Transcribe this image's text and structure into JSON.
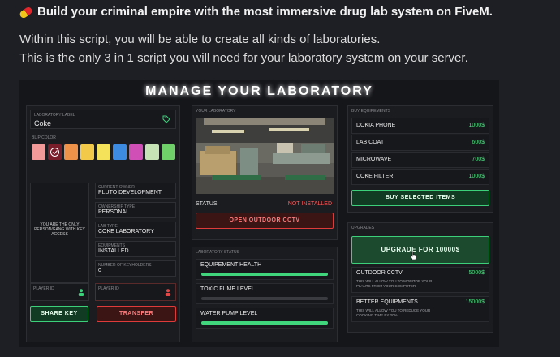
{
  "post": {
    "headline": "Build your criminal empire with the most immersive drug lab system on FiveM.",
    "line1": "Within this script, you will be able to create all kinds of laboratories.",
    "line2": "This is the only 3 in 1 script you will need for your laboratory system on your server."
  },
  "ui": {
    "title": "MANAGE YOUR LABORATORY",
    "lab_label_caption": "LABORATORY LABEL",
    "lab_label_value": "Coke",
    "blip_color_caption": "BLIP COLOR",
    "blip_colors": [
      "#f29a9a",
      "#7a1d2b",
      "#ee9149",
      "#f3c94a",
      "#f4e25a",
      "#3d8be0",
      "#d04fb6",
      "#c6e3b5",
      "#6fd06a"
    ],
    "key_access_text": "YOU ARE THE ONLY PERSON/GANG WITH KEY ACCESS",
    "owner_caption": "CURRENT OWNER",
    "owner_value": "PLUTO DEVELOPMENT",
    "ownership_caption": "OWNERSHIP TYPE",
    "ownership_value": "PERSONAL",
    "labtype_caption": "LAB TYPE",
    "labtype_value": "COKE LABORATORY",
    "equipments_caption": "EQUIPMENTS",
    "equipments_value": "INSTALLED",
    "keyholders_caption": "NUMBER OF KEYHOLDERS",
    "keyholders_value": "0",
    "player_id_caption": "PLAYER ID",
    "player_id_caption2": "PLAYER ID",
    "share_key": "SHARE KEY",
    "transfer": "TRANSFER",
    "your_lab_caption": "YOUR LABORATORY",
    "status_label": "STATUS",
    "status_value": "NOT INSTALLED",
    "cctv_button": "OPEN OUTDOOR CCTV",
    "lab_status_caption": "LABORATORY STATUS",
    "statuses": [
      {
        "name": "EQUIPEMENT HEALTH",
        "level": 1.0
      },
      {
        "name": "TOXIC FUME LEVEL",
        "level": 0.0
      },
      {
        "name": "WATER PUMP LEVEL",
        "level": 1.0
      }
    ],
    "buy_caption": "BUY EQUIPEMENTS",
    "equipment": [
      {
        "name": "DOKIA PHONE",
        "price": "1000$"
      },
      {
        "name": "LAB COAT",
        "price": "600$"
      },
      {
        "name": "MICROWAVE",
        "price": "700$"
      },
      {
        "name": "COKE FILTER",
        "price": "1000$"
      }
    ],
    "buy_button": "BUY SELECTED ITEMS",
    "upgrades_caption": "UPGRADES",
    "upgrade_button": "UPGRADE FOR 10000$",
    "upgrades": [
      {
        "name": "OUTDOOR CCTV",
        "price": "5000$",
        "desc": "THIS WILL ALLOW YOU TO MONITOR YOUR PLANTS FROM YOUR COMPUTER."
      },
      {
        "name": "BETTER EQUIPMENTS",
        "price": "15000$",
        "desc": "THIS WILL ALLOW YOU TO REDUCE YOUR COOKING TIME BY 20%"
      }
    ]
  }
}
